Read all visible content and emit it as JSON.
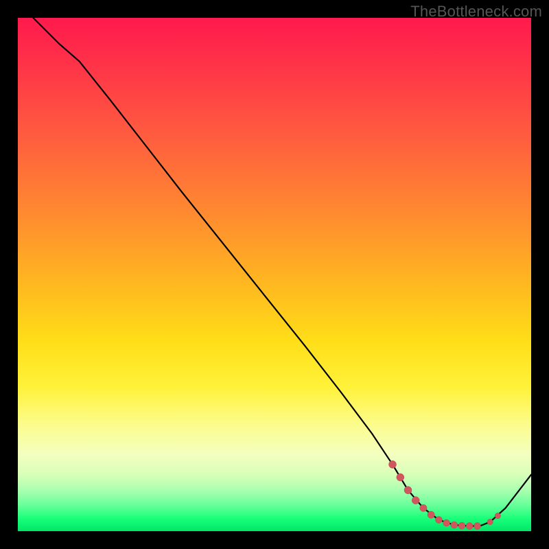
{
  "watermark": "TheBottleneck.com",
  "colors": {
    "gradient_top": "#ff1a4d",
    "gradient_bottom": "#00e668",
    "line": "#000000",
    "dots": "#d1575f"
  },
  "chart_data": {
    "type": "line",
    "title": "",
    "xlabel": "",
    "ylabel": "",
    "xlim": [
      0,
      100
    ],
    "ylim": [
      0,
      100
    ],
    "series": [
      {
        "name": "curve",
        "x": [
          3,
          8,
          12,
          18,
          25,
          32,
          40,
          48,
          56,
          63,
          69,
          73,
          76,
          79,
          82,
          85,
          88,
          90,
          92,
          95,
          100
        ],
        "y": [
          100,
          95,
          91.5,
          84,
          75,
          66,
          56,
          46,
          36,
          27,
          19,
          13,
          8,
          4.5,
          2.2,
          1.2,
          1.0,
          1.0,
          1.8,
          4.5,
          11
        ]
      }
    ],
    "markers": {
      "name": "highlight-dots",
      "x": [
        73,
        74.5,
        76,
        77.5,
        79,
        80.5,
        82,
        83.5,
        85,
        86.5,
        88,
        89.5,
        92,
        93.5
      ],
      "y": [
        13,
        10.5,
        8,
        6,
        4.5,
        3.2,
        2.2,
        1.6,
        1.2,
        1.05,
        1.0,
        1.0,
        1.8,
        3.0
      ],
      "r": [
        5.5,
        5.5,
        5.5,
        5.5,
        5.2,
        5.2,
        5.0,
        5.0,
        5.0,
        5.0,
        5.0,
        5.0,
        4.2,
        4.2
      ]
    }
  }
}
